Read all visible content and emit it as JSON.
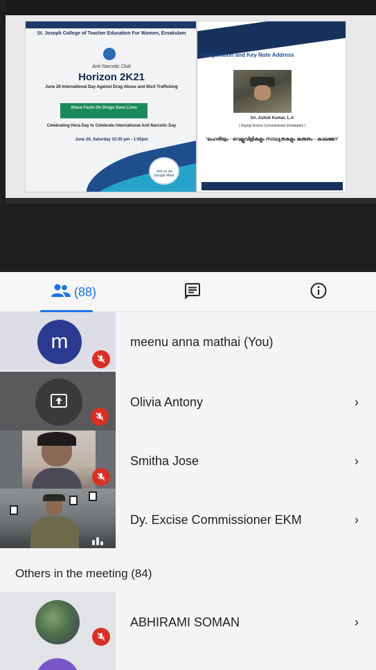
{
  "tabs": {
    "people_count": "(88)"
  },
  "shared_screen": {
    "left_slide": {
      "college": "St. Joseph College of Teacher Education For Women, Ernakulam",
      "club": "Anti Narcotic Club",
      "title": "Horizon 2K21",
      "subtitle": "June 26 International Day Against Drug Abuse and Illicit Trafficking",
      "tagline": "Share Facts On Drugs Save Lives",
      "note": "Celebrating Hora Day to Celebrate International Anti Narcotic Day",
      "date": "June 26, Saturday 10:30 pm - 1:00pm",
      "meet_label": "Join us via Google Meet"
    },
    "right_slide": {
      "title": "Inauguration and Key Note Address",
      "speaker": "Sri. Ashok Kumar. L.A",
      "role": "( Deputy Excise Commissioner Ernakulam )",
      "topic": "'ലഹരിയും - വെല്ലുവിളികളും സാധ്യതകളും കരുതം - കാലമേറ'"
    }
  },
  "participants": [
    {
      "name": "meenu anna mathai (You)",
      "initial": "m",
      "avatar_color": "#2a3b8f",
      "muted": true,
      "has_chevron": false
    },
    {
      "name": "Olivia Antony",
      "muted": true,
      "has_chevron": true
    },
    {
      "name": "Smitha Jose",
      "muted": true,
      "has_chevron": true
    },
    {
      "name": "Dy. Excise Commissioner EKM",
      "muted": false,
      "has_chevron": true
    }
  ],
  "others_header": "Others in the meeting (84)",
  "others": [
    {
      "name": "ABHIRAMI SOMAN",
      "muted": true,
      "has_chevron": true
    }
  ],
  "colors": {
    "accent": "#1a73e8",
    "mute_red": "#d93025"
  }
}
